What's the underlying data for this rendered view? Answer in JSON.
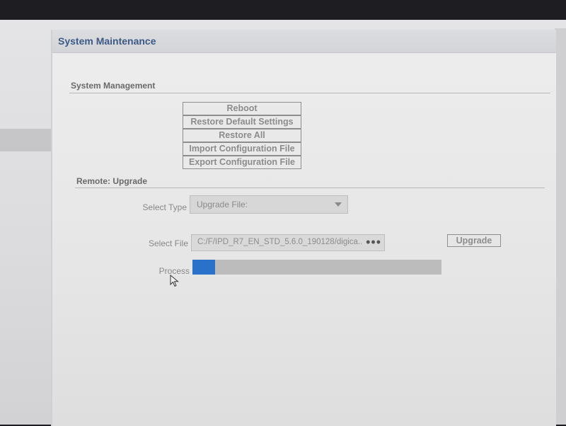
{
  "panel": {
    "title": "System Maintenance"
  },
  "system_management": {
    "title": "System Management",
    "buttons": [
      {
        "label": "Reboot"
      },
      {
        "label": "Restore Default Settings"
      },
      {
        "label": "Restore All"
      },
      {
        "label": "Import Configuration File"
      },
      {
        "label": "Export Configuration File"
      }
    ]
  },
  "remote_upgrade": {
    "title": "Remote: Upgrade",
    "select_type": {
      "label": "Select Type",
      "value": "Upgrade File:"
    },
    "select_file": {
      "label": "Select File",
      "value": "C:/F/IPD_R7_EN_STD_5.6.0_190128/digica...",
      "browse_label": "•••"
    },
    "upgrade_label": "Upgrade",
    "process": {
      "label": "Process",
      "progress": 0.09
    }
  },
  "colors": {
    "accent": "#2a72c9",
    "title": "#3d5a86"
  }
}
